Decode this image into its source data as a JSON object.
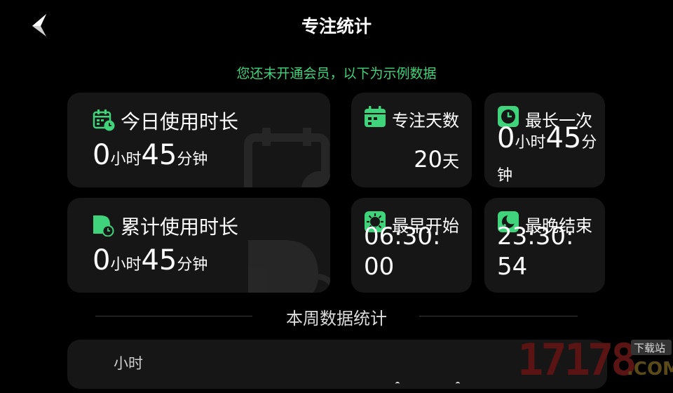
{
  "header": {
    "title": "专注统计",
    "back_icon": "back-chevron-icon"
  },
  "notice": "您还未开通会员，以下为示例数据",
  "cards": {
    "today": {
      "label": "今日使用时长",
      "hours": "0",
      "hours_unit": "小时",
      "minutes": "45",
      "minutes_unit": "分钟",
      "icon": "calendar-clock-icon"
    },
    "total": {
      "label": "累计使用时长",
      "hours": "0",
      "hours_unit": "小时",
      "minutes": "45",
      "minutes_unit": "分钟",
      "icon": "document-clock-icon"
    },
    "days": {
      "label": "专注天数",
      "value": "20",
      "unit": "天",
      "icon": "calendar-icon"
    },
    "longest": {
      "label": "最长一次",
      "hours": "0",
      "hours_unit": "小时",
      "minutes": "45",
      "minutes_unit": "分钟",
      "icon": "clock-icon"
    },
    "earliest": {
      "label": "最早开始",
      "value": "06:30:00",
      "icon": "sun-icon"
    },
    "latest": {
      "label": "最晚结束",
      "value": "23:30:54",
      "icon": "moon-icon"
    }
  },
  "weekly": {
    "title": "本周数据统计",
    "y_unit": "小时"
  },
  "watermark": {
    "text": "17178",
    "suffix": ".COM",
    "tag": "下载站"
  },
  "colors": {
    "accent": "#3fd37b",
    "card_bg": "#161616",
    "background": "#000000"
  }
}
